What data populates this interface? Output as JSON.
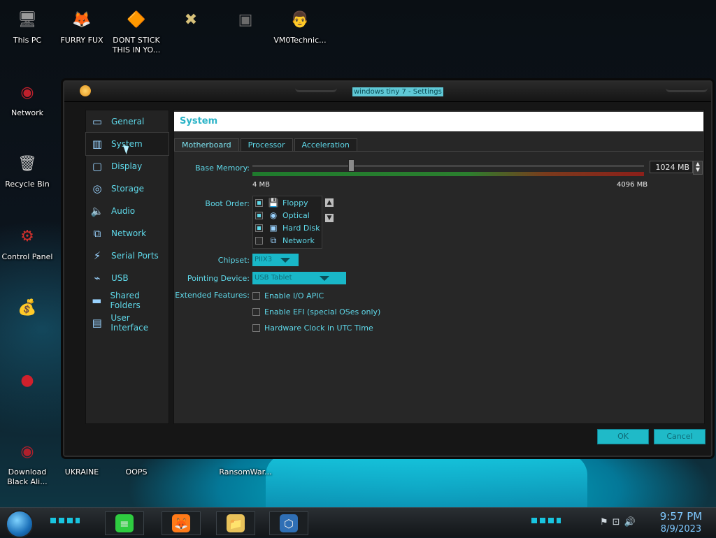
{
  "desktop": {
    "icons": [
      {
        "label": "This PC",
        "icon": "computer-icon",
        "glyph": "🖥"
      },
      {
        "label": "FURRY FUX",
        "icon": "firefox-icon",
        "glyph": "🦊"
      },
      {
        "label": "DONT STICK THIS IN YO...",
        "icon": "vlc-cone-icon",
        "glyph": "🔶"
      },
      {
        "label": "",
        "icon": "hex-editor-icon",
        "glyph": "✖"
      },
      {
        "label": "",
        "icon": "xonix-game-icon",
        "glyph": "▣"
      },
      {
        "label": "VM0Technic...",
        "icon": "doctor-avatar-icon",
        "glyph": "👨"
      },
      {
        "label": "Network",
        "icon": "network-orb-icon",
        "glyph": "◉"
      },
      {
        "label": "Recycle Bin",
        "icon": "recycle-bin-icon",
        "glyph": "🗑"
      },
      {
        "label": "Control Panel",
        "icon": "control-panel-icon",
        "glyph": "⚙"
      },
      {
        "label": "",
        "icon": "money-bag-icon",
        "glyph": "💰"
      },
      {
        "label": "",
        "icon": "red-creature-icon",
        "glyph": "●"
      },
      {
        "label": "Download Black Ali...",
        "icon": "download-orb-icon",
        "glyph": "◉"
      },
      {
        "label": "UKRAINE",
        "icon": "ukraine-icon",
        "glyph": "⚑"
      },
      {
        "label": "OOPS",
        "icon": "oops-icon",
        "glyph": "✦"
      },
      {
        "label": "",
        "icon": "flag-file-icon",
        "glyph": "⚐"
      },
      {
        "label": "RansomWar...",
        "icon": "ransomware-icon",
        "glyph": "☠"
      }
    ]
  },
  "window": {
    "title": "windows tiny 7 - Settings",
    "nav": [
      {
        "label": "General",
        "icon": "general-icon",
        "glyph": "▭"
      },
      {
        "label": "System",
        "icon": "system-icon",
        "glyph": "▥"
      },
      {
        "label": "Display",
        "icon": "display-icon",
        "glyph": "▢"
      },
      {
        "label": "Storage",
        "icon": "storage-icon",
        "glyph": "◎"
      },
      {
        "label": "Audio",
        "icon": "audio-icon",
        "glyph": "🔈"
      },
      {
        "label": "Network",
        "icon": "network-icon",
        "glyph": "⧉"
      },
      {
        "label": "Serial Ports",
        "icon": "serial-ports-icon",
        "glyph": "⚡"
      },
      {
        "label": "USB",
        "icon": "usb-icon",
        "glyph": "⌁"
      },
      {
        "label": "Shared Folders",
        "icon": "shared-folders-icon",
        "glyph": "▬"
      },
      {
        "label": "User Interface",
        "icon": "user-interface-icon",
        "glyph": "▤"
      }
    ],
    "selected_nav": "System",
    "section_title": "System",
    "tabs": [
      "Motherboard",
      "Processor",
      "Acceleration"
    ],
    "selected_tab": "Motherboard",
    "base_memory": {
      "label": "Base Memory:",
      "value": "1024 MB",
      "value_mb": 1024,
      "min_mb": 4,
      "max_mb": 4096,
      "min_label": "4 MB",
      "max_label": "4096 MB"
    },
    "boot_order": {
      "label": "Boot Order:",
      "items": [
        {
          "label": "Floppy",
          "checked": true,
          "icon": "floppy-icon",
          "glyph": "💾"
        },
        {
          "label": "Optical",
          "checked": true,
          "icon": "optical-disc-icon",
          "glyph": "◉"
        },
        {
          "label": "Hard Disk",
          "checked": true,
          "icon": "hard-disk-icon",
          "glyph": "▣"
        },
        {
          "label": "Network",
          "checked": false,
          "icon": "network-boot-icon",
          "glyph": "⧉"
        }
      ]
    },
    "chipset": {
      "label": "Chipset:",
      "value": "PIIX3"
    },
    "pointing_device": {
      "label": "Pointing Device:",
      "value": "USB Tablet"
    },
    "extended_features": {
      "label": "Extended Features:",
      "options": [
        {
          "label": "Enable I/O APIC",
          "checked": false
        },
        {
          "label": "Enable EFI (special OSes only)",
          "checked": false
        },
        {
          "label": "Hardware Clock in UTC Time",
          "checked": false
        }
      ]
    },
    "buttons": {
      "ok": "OK",
      "cancel": "Cancel"
    }
  },
  "taskbar": {
    "apps": [
      {
        "name": "notes-app",
        "icon": "green-notes-icon",
        "glyph": "≡",
        "color": "#2ecc40"
      },
      {
        "name": "firefox",
        "icon": "firefox-taskbar-icon",
        "glyph": "🦊",
        "color": "#ff7a18"
      },
      {
        "name": "file-explorer",
        "icon": "folder-icon",
        "glyph": "📁",
        "color": "#e8c25a"
      },
      {
        "name": "virtualbox",
        "icon": "virtualbox-icon",
        "glyph": "⬡",
        "color": "#2f6fb5"
      }
    ],
    "tray_icons": [
      "flag-alert-icon",
      "network-tray-icon",
      "volume-icon"
    ],
    "time": "9:57 PM",
    "date": "8/9/2023"
  },
  "colors": {
    "accent": "#19b7c8",
    "label_cyan": "#5fd9ea"
  }
}
